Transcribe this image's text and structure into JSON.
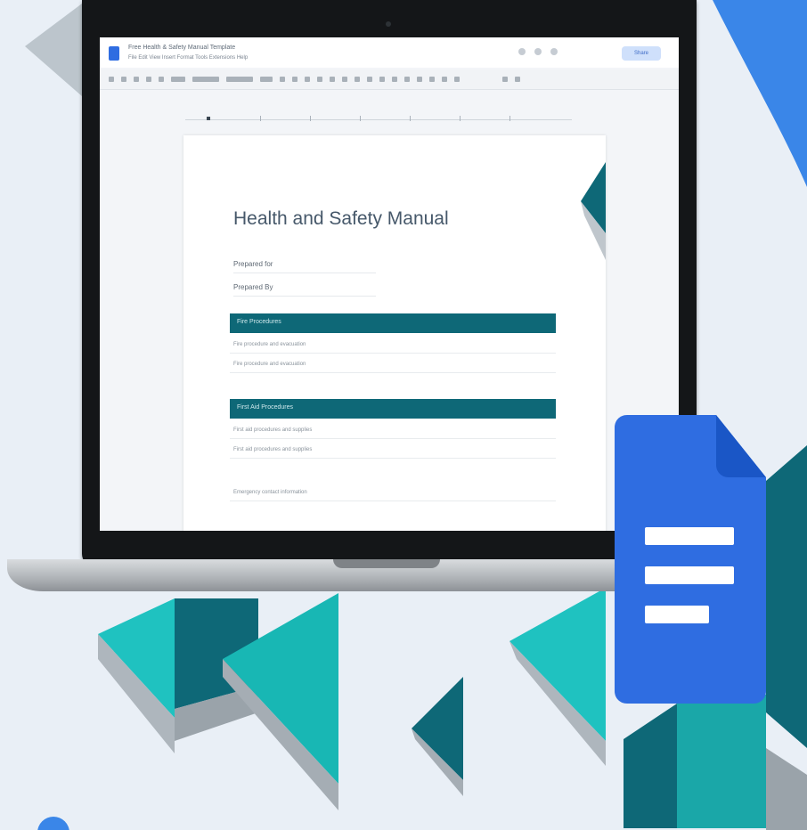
{
  "document": {
    "window_title": "Free Health & Safety Manual Template",
    "menu_bar": "File  Edit  View  Insert  Format  Tools  Extensions  Help",
    "share_label": "Share",
    "heading": "Health and Safety Manual",
    "fields": [
      "Prepared for",
      "Prepared By"
    ],
    "sections": [
      {
        "title": "Fire Procedures",
        "rows": [
          "Fire procedure and evacuation",
          "Fire procedure and evacuation"
        ]
      },
      {
        "title": "First Aid Procedures",
        "rows": [
          "First aid procedures and supplies",
          "First aid procedures and supplies"
        ]
      }
    ],
    "footer_row": "Emergency contact information"
  },
  "colors": {
    "background": "#e9eff6",
    "teal_dark": "#0e6877",
    "teal_light": "#1fc2c0",
    "docs_blue": "#2f6de1",
    "accent_blue": "#3a86e8"
  },
  "icons": [
    "google-docs-icon",
    "doc-icon"
  ]
}
